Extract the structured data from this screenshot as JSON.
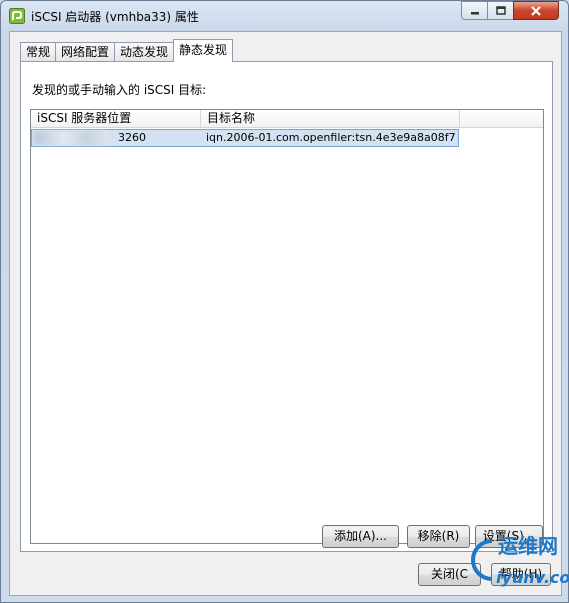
{
  "window": {
    "title": "iSCSI 启动器 (vmhba33) 属性"
  },
  "tabs": [
    {
      "label": "常规"
    },
    {
      "label": "网络配置"
    },
    {
      "label": "动态发现"
    },
    {
      "label": "静态发现"
    }
  ],
  "panel": {
    "label": "发现的或手动输入的 iSCSI 目标:"
  },
  "list": {
    "columns": [
      "iSCSI 服务器位置",
      "目标名称"
    ],
    "rows": [
      {
        "server": "3260",
        "target": "iqn.2006-01.com.openfiler:tsn.4e3e9a8a08f7"
      }
    ]
  },
  "buttons": {
    "add": "添加(A)...",
    "remove": "移除(R)",
    "settings": "设置(S)...",
    "close": "关闭(C",
    "help": "帮助(H)"
  },
  "watermark": {
    "line1": "运维网",
    "line2": "iyunv.com"
  },
  "colors": {
    "selection": "#d2e2f2",
    "accent": "#1e78c8"
  }
}
